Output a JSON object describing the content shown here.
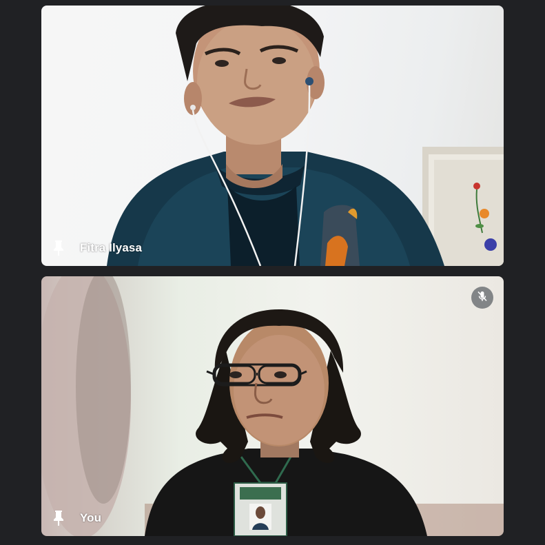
{
  "participants": [
    {
      "name": "Fitra Ilyasa",
      "pin_icon": "pin-icon",
      "muted": false
    },
    {
      "name": "You",
      "pin_icon": "pin-icon",
      "muted": true,
      "mute_icon": "mic-off-icon"
    }
  ],
  "colors": {
    "app_background": "#202124",
    "name_text": "#ffffff",
    "mute_badge": "#5f6368"
  }
}
